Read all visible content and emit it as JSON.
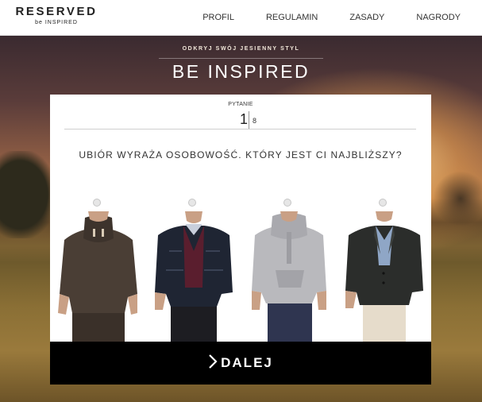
{
  "header": {
    "logo_main": "RESERVED",
    "logo_sub": "be INSPIRED",
    "nav": [
      "PROFIL",
      "REGULAMIN",
      "ZASADY",
      "NAGRODY"
    ]
  },
  "hero": {
    "subtitle": "ODKRYJ SWÓJ JESIENNY STYL",
    "title": "BE INSPIRED"
  },
  "quiz": {
    "question_label": "PYTANIE",
    "current_number": "1",
    "total_number": "8",
    "question": "UBIÓR WYRAŻA OSOBOWOŚĆ. KTÓRY JEST CI NAJBLIŻSZY?",
    "options": [
      {
        "selected": false,
        "garment": "brown knit sweater with toggle collar"
      },
      {
        "selected": false,
        "garment": "navy quilted jacket over burgundy sweater"
      },
      {
        "selected": false,
        "garment": "grey hooded sweatshirt"
      },
      {
        "selected": false,
        "garment": "dark grey blazer with chinos"
      }
    ],
    "next_label": "DALEJ"
  },
  "colors": {
    "header_bg": "#ffffff",
    "card_bg": "#ffffff",
    "button_bg": "#000000",
    "button_text": "#ffffff"
  }
}
